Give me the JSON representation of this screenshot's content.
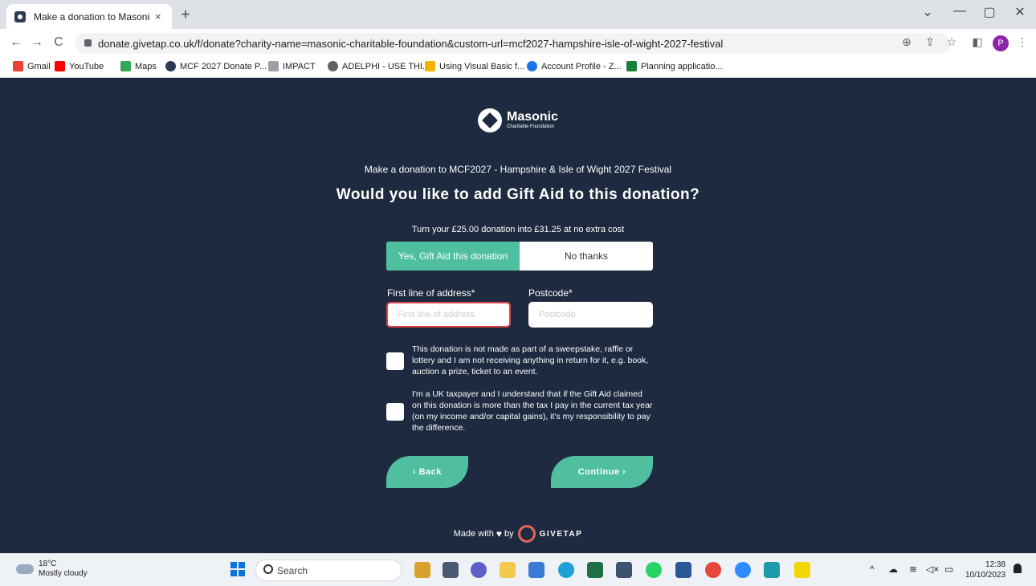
{
  "browser": {
    "tab_title": "Make a donation to Masonic Ch",
    "tab_close": "×",
    "new_tab": "+",
    "win_minimize": "—",
    "win_restore": "▢",
    "win_close": "✕",
    "win_dropdown": "⌄",
    "back": "←",
    "forward": "→",
    "reload": "C",
    "url": "donate.givetap.co.uk/f/donate?charity-name=masonic-charitable-foundation&custom-url=mcf2027-hampshire-isle-of-wight-2027-festival",
    "profile_initial": "P",
    "toolbar_icons": [
      "zoom-icon",
      "share-icon",
      "star-icon",
      "sidepanel-icon",
      "menu-icon"
    ]
  },
  "bookmarks": [
    {
      "label": "Gmail",
      "color": "#ea4335"
    },
    {
      "label": "YouTube",
      "color": "#ff0000"
    },
    {
      "label": "Maps",
      "color": "#34a853"
    },
    {
      "label": "MCF 2027 Donate P...",
      "color": "#2d3b52"
    },
    {
      "label": "IMPACT",
      "color": "#9aa0a6"
    },
    {
      "label": "ADELPHI - USE THI...",
      "color": "#5f6368"
    },
    {
      "label": "Using Visual Basic f...",
      "color": "#f4b400"
    },
    {
      "label": "Account Profile - Z...",
      "color": "#1a73e8"
    },
    {
      "label": "Planning applicatio...",
      "color": "#188038"
    }
  ],
  "page": {
    "logo_name": "Masonic",
    "logo_sub": "Charitable Foundation",
    "subtitle": "Make a donation to MCF2027 - Hampshire & Isle of Wight 2027 Festival",
    "heading": "Would you like to add Gift Aid to this donation?",
    "offer": "Turn your £25.00 donation into £31.25 at no extra cost",
    "toggle_yes": "Yes, Gift Aid this donation",
    "toggle_no": "No thanks",
    "address_label": "First line of address*",
    "address_placeholder": "First line of address",
    "address_value": "",
    "postcode_label": "Postcode*",
    "postcode_placeholder": "Postcode",
    "postcode_value": "",
    "declaration_1": "This donation is not made as part of a sweepstake, raffle or lottery and I am not receiving anything in return for it, e.g. book, auction a prize, ticket to an event.",
    "declaration_2": "I'm a UK taxpayer and I understand that if the Gift Aid claimed on this donation is more than the tax I pay in the current tax year (on my income and/or capital gains), it's my responsibility to pay the difference.",
    "back_label": "‹ Back",
    "continue_label": "Continue ›",
    "made_with": "Made with",
    "heart": "♥",
    "by": "by",
    "brand": "GIVETAP",
    "accent_color": "#4fbf9f",
    "bg_color": "#1e2a3f",
    "error_color": "#e0424b"
  },
  "taskbar": {
    "temp": "18°C",
    "weather": "Mostly cloudy",
    "search": "Search",
    "time": "12:38",
    "date": "10/10/2023",
    "tray_up": "^",
    "apps": [
      {
        "name": "copilot-icon",
        "color": "#d8a12b"
      },
      {
        "name": "files-icon",
        "color": "#4a5a73"
      },
      {
        "name": "teams-chat-icon",
        "color": "#5b5fc7"
      },
      {
        "name": "file-explorer-icon",
        "color": "#f2c94c"
      },
      {
        "name": "store-icon",
        "color": "#3a7bd5"
      },
      {
        "name": "edge-icon",
        "color": "#1fa0d8"
      },
      {
        "name": "excel-icon",
        "color": "#1d7044"
      },
      {
        "name": "calendar-icon",
        "color": "#3b5270"
      },
      {
        "name": "whatsapp-icon",
        "color": "#25d366"
      },
      {
        "name": "word-icon",
        "color": "#2b5797"
      },
      {
        "name": "chrome-icon",
        "color": "#e8453c"
      },
      {
        "name": "zoom-icon",
        "color": "#2d8cff"
      },
      {
        "name": "calculator-icon",
        "color": "#1c9aa8"
      },
      {
        "name": "norton-icon",
        "color": "#f2d600"
      }
    ]
  }
}
